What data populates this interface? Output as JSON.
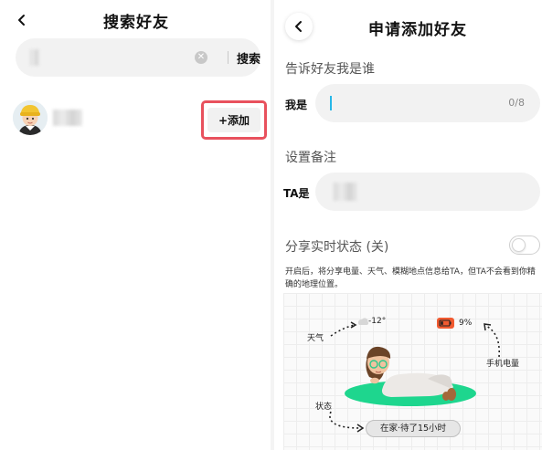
{
  "left_panel": {
    "title": "搜索好友",
    "search_button": "搜索",
    "clear_icon": "close-circle-icon",
    "result": {
      "add_button": "+添加"
    }
  },
  "right_panel": {
    "title": "申请添加好友",
    "intro_section": {
      "heading": "告诉好友我是谁",
      "field_label": "我是",
      "counter": "0/8"
    },
    "remark_section": {
      "heading": "设置备注",
      "field_label": "TA是"
    },
    "realtime_status": {
      "heading": "分享实时状态 (关)",
      "enabled": false,
      "description": "开启后，将分享电量、天气、模糊地点信息给TA，但TA不会看到你精确的地理位置。"
    },
    "illustration": {
      "weather_label": "天气",
      "temperature": "-12°",
      "battery_percent": "9%",
      "battery_label": "手机电量",
      "status_label": "状态",
      "status_text": "在家·待了15小时"
    }
  },
  "colors": {
    "highlight_border": "#e8515d",
    "caret": "#28b8e8",
    "battery": "#f15a30",
    "mat": "#1ed68e"
  }
}
